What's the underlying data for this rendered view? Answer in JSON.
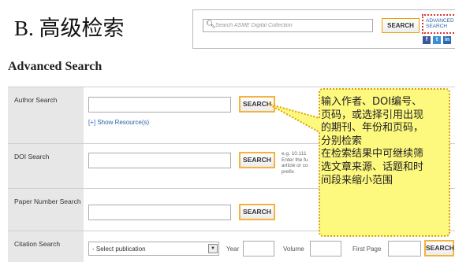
{
  "slide": {
    "title": "B. 高级检索"
  },
  "header": {
    "search_placeholder": "Search ASME Digital Collection",
    "search_button": "SEARCH",
    "advanced_link": "ADVANCED SEARCH",
    "social_icons": [
      "facebook-icon",
      "twitter-icon",
      "linkedin-icon"
    ]
  },
  "page": {
    "heading": "Advanced Search"
  },
  "rows": {
    "author": {
      "label": "Author Search",
      "button": "SEARCH",
      "show_resources": "[+] Show Resource(s)"
    },
    "doi": {
      "label": "DOI Search",
      "button": "SEARCH",
      "hint": "e.g. 10.111 Enter the fu article or co prefix"
    },
    "paper_number": {
      "label": "Paper Number Search",
      "button": "SEARCH"
    },
    "citation": {
      "label": "Citation Search",
      "publication_select": "- Select publication",
      "year_label": "Year",
      "volume_label": "Volume",
      "first_page_label": "First Page",
      "button": "SEARCH"
    }
  },
  "callout": {
    "lines": [
      "输入作者、DOI编号、",
      "页码，或选择引用出现",
      "的期刊、年份和页码，",
      "分别检索",
      "在检索结果中可继续筛",
      "选文章来源、话题和时",
      "间段来缩小范围"
    ],
    "colors": {
      "fill": "#fdf87e",
      "border": "#e0a000"
    }
  }
}
